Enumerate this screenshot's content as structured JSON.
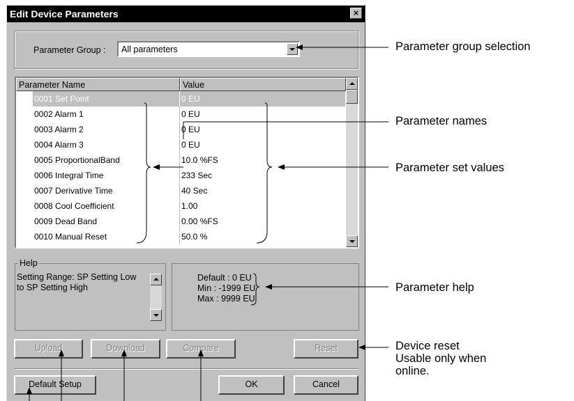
{
  "dialog": {
    "title": "Edit Device Parameters",
    "close_glyph": "×",
    "group_label": "Parameter Group :",
    "group_value": "All parameters"
  },
  "table": {
    "headers": [
      "Parameter Name",
      "Value"
    ],
    "rows": [
      {
        "name": "0001 Set Point",
        "value": "0 EU",
        "selected": true
      },
      {
        "name": "0002 Alarm 1",
        "value": "0 EU"
      },
      {
        "name": "0003 Alarm 2",
        "value": "0 EU"
      },
      {
        "name": "0004 Alarm 3",
        "value": "0 EU"
      },
      {
        "name": "0005 ProportionalBand",
        "value": "10.0 %FS"
      },
      {
        "name": "0006 Integral Time",
        "value": "233 Sec"
      },
      {
        "name": "0007 Derivative Time",
        "value": "40 Sec"
      },
      {
        "name": "0008 Cool Coefficient",
        "value": "1.00"
      },
      {
        "name": "0009 Dead Band",
        "value": "0.00 %FS"
      },
      {
        "name": "0010 Manual Reset",
        "value": "50.0 %"
      }
    ]
  },
  "help": {
    "legend": "Help",
    "text_line1": "Setting Range: SP Setting Low",
    "text_line2": "to SP Setting High",
    "default": "Default : 0 EU",
    "min": "Min : -1999 EU",
    "max": "Max : 9999 EU"
  },
  "buttons": {
    "upload": "Upload",
    "download": "Download",
    "compare": "Compare",
    "reset": "Reset",
    "default_setup": "Default Setup",
    "ok": "OK",
    "cancel": "Cancel"
  },
  "callouts": {
    "group_selection": "Parameter group selection",
    "names": "Parameter names",
    "set_values": "Parameter set values",
    "help": "Parameter help",
    "reset_line1": "Device reset",
    "reset_line2": "Usable only when",
    "reset_line3": "online."
  },
  "colors": {
    "dialog_face": "#c0c0c0",
    "title_bar": "#000000",
    "selection": "#000000"
  }
}
